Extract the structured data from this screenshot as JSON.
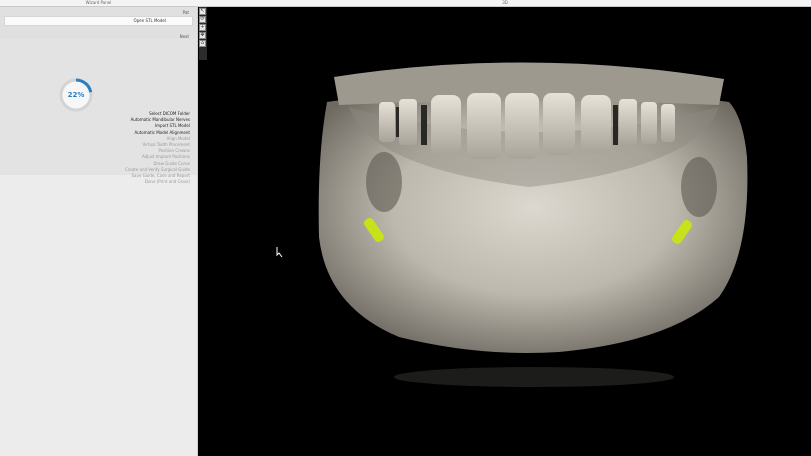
{
  "topbar": {
    "wizard_title": "Wizard Panel",
    "view_title": "3D"
  },
  "patient": {
    "label": "Pat",
    "value": "Open STL Model"
  },
  "section_label": "Next",
  "progress": {
    "percent_label": "22%",
    "value": 0.22
  },
  "steps": [
    {
      "label": "Select DICOM Folder",
      "state": "done"
    },
    {
      "label": "Automatic Mandibular Nerves",
      "state": "done"
    },
    {
      "label": "Import STL Model",
      "state": "done"
    },
    {
      "label": "Automatic Model Alignment",
      "state": "done"
    },
    {
      "label": "Align Model",
      "state": "todo"
    },
    {
      "label": "Virtual Tooth Placement",
      "state": "todo"
    },
    {
      "label": "Position Crowns",
      "state": "todo"
    },
    {
      "label": "Adjust Implant Positions",
      "state": "todo"
    },
    {
      "label": "Draw Guide Curve",
      "state": "todo"
    },
    {
      "label": "Create and Verify Surgical Guide",
      "state": "todo"
    },
    {
      "label": "Save Guide, Case and Report",
      "state": "todo"
    },
    {
      "label": "Done (Print and Close)",
      "state": "todo"
    }
  ],
  "colors": {
    "accent": "#2a7fc1",
    "implant": "#c7e21a",
    "bone": "#cfcac0"
  },
  "icons": [
    "pointer-tool-icon",
    "rotate-tool-icon",
    "zoom-tool-icon",
    "pan-tool-icon",
    "reset-view-icon"
  ]
}
